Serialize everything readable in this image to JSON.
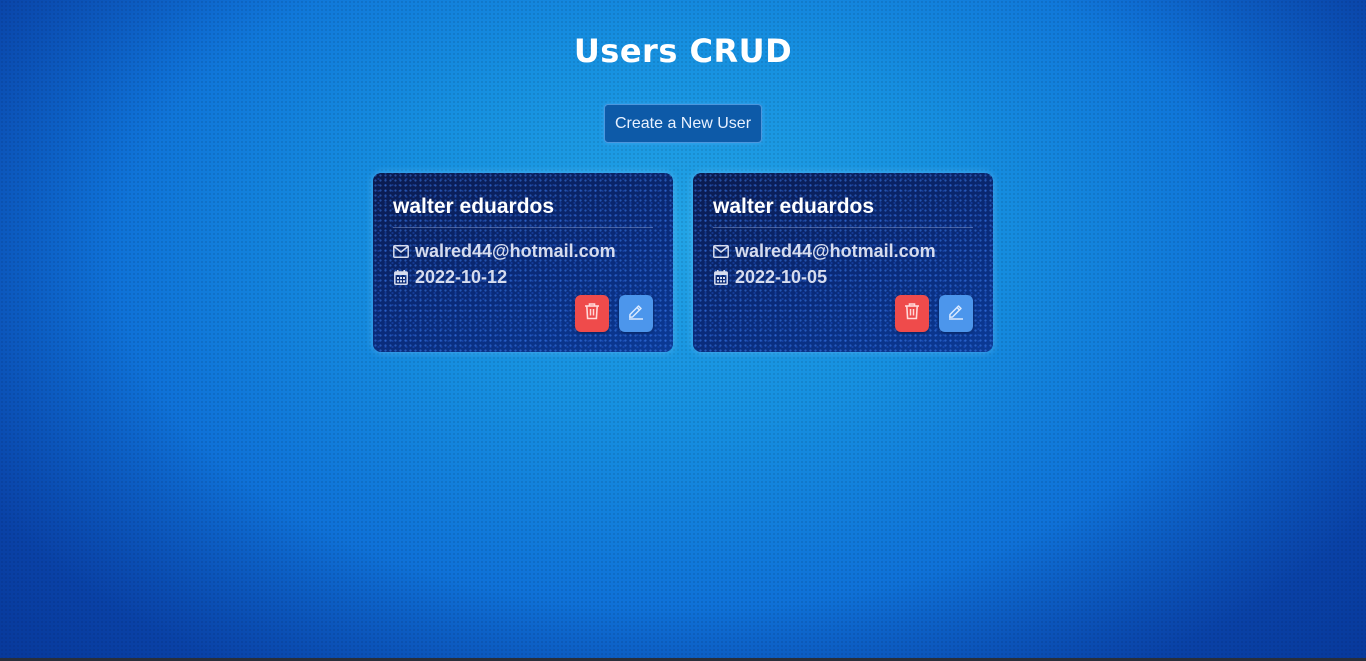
{
  "header": {
    "title": "Users CRUD"
  },
  "actions": {
    "create_label": "Create a New User"
  },
  "users": [
    {
      "name": "walter eduardos",
      "email": "walred44@hotmail.com",
      "birthday": "2022-10-12"
    },
    {
      "name": "walter eduardos",
      "email": "walred44@hotmail.com",
      "birthday": "2022-10-05"
    }
  ],
  "icons": {
    "email": "mail-icon",
    "birthday": "calendar-icon",
    "delete": "trash-icon",
    "edit": "pencil-icon"
  },
  "colors": {
    "delete_button": "#ef4b4b",
    "edit_button": "#4c96ec",
    "create_button": "#0d5aa8"
  }
}
